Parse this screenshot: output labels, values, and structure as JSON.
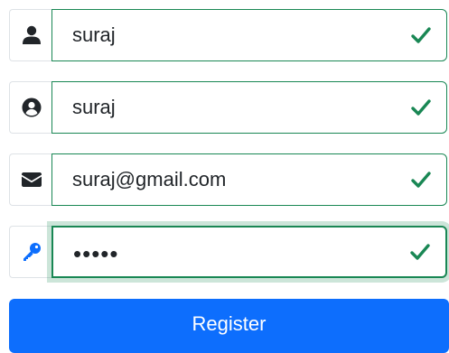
{
  "form": {
    "fields": [
      {
        "icon": "user-icon",
        "value": "suraj",
        "status": "valid"
      },
      {
        "icon": "user-circle-icon",
        "value": "suraj",
        "status": "valid"
      },
      {
        "icon": "envelope-icon",
        "value": "suraj@gmail.com",
        "status": "valid"
      },
      {
        "icon": "key-icon",
        "value": "•••••",
        "status": "valid",
        "type": "password"
      }
    ],
    "register_label": "Register"
  },
  "colors": {
    "valid": "#198754",
    "primary": "#0d6efd",
    "icon": "#212529",
    "key_icon": "#0d6efd"
  }
}
